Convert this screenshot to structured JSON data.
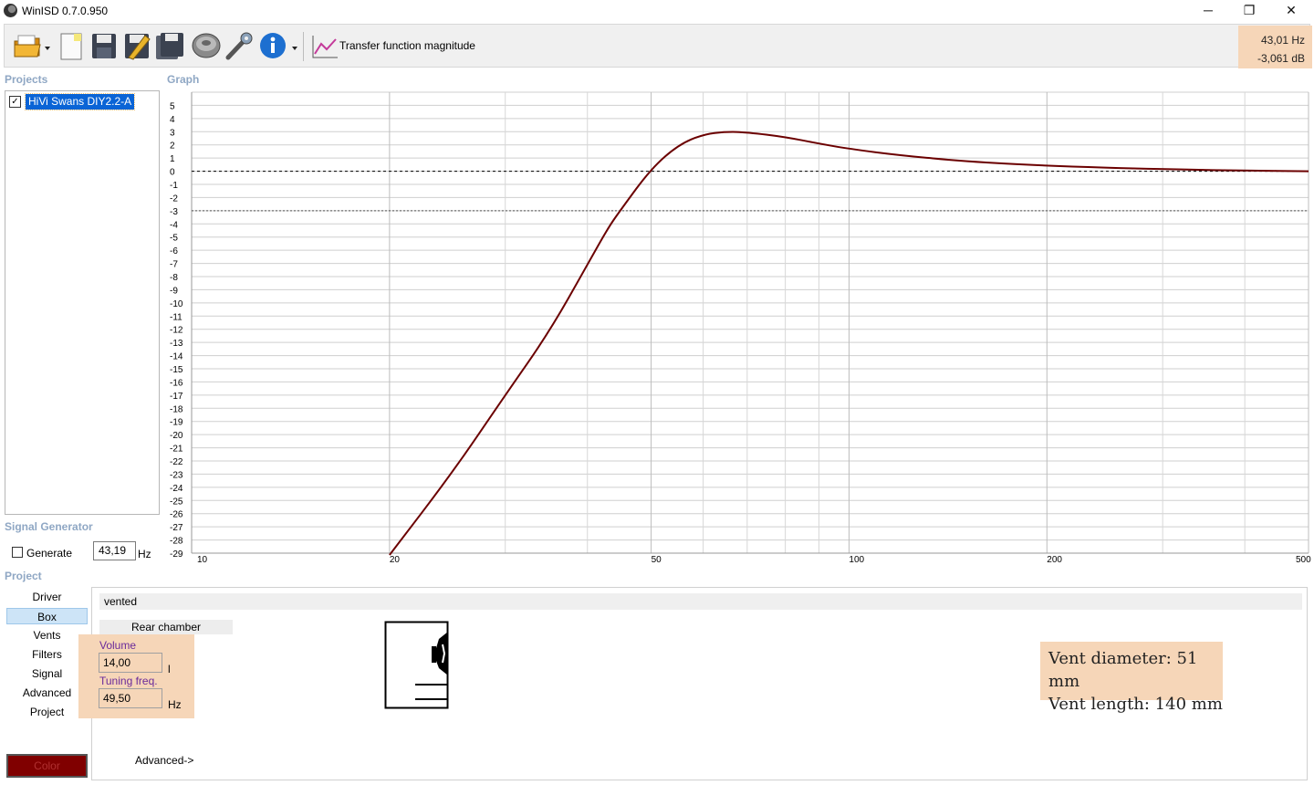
{
  "window": {
    "title": "WinISD 0.7.0.950",
    "minimize": "─",
    "restore": "❐",
    "close": "✕"
  },
  "toolbar": {
    "icons": [
      "open-folder-icon",
      "new-document-icon",
      "save-icon",
      "save-as-icon",
      "save-all-icon",
      "driver-icon",
      "tools-icon",
      "info-icon",
      "graph-type-icon"
    ],
    "graph_type_label": "Transfer function magnitude"
  },
  "cursor_readout": {
    "frequency": "43,01 Hz",
    "level": "-3,061 dB"
  },
  "projects": {
    "label": "Projects",
    "items": [
      {
        "name": "HiVi Swans DIY2.2-A",
        "checked": true
      }
    ]
  },
  "graph": {
    "label": "Graph"
  },
  "chart_data": {
    "type": "line",
    "title": "",
    "xlabel": "",
    "ylabel": "",
    "xscale": "log",
    "xlim": [
      10,
      500
    ],
    "ylim": [
      -29,
      5
    ],
    "x_tick_labels": [
      "10",
      "20",
      "50",
      "100",
      "200",
      "500"
    ],
    "y_tick_labels": [
      "5",
      "4",
      "3",
      "2",
      "1",
      "0",
      "-1",
      "-2",
      "-3",
      "-4",
      "-5",
      "-6",
      "-7",
      "-8",
      "-9",
      "-10",
      "-11",
      "-12",
      "-13",
      "-14",
      "-15",
      "-16",
      "-17",
      "-18",
      "-19",
      "-20",
      "-21",
      "-22",
      "-23",
      "-24",
      "-25",
      "-26",
      "-27",
      "-28",
      "-29"
    ],
    "reference_lines": [
      0,
      -3
    ],
    "grid": true,
    "series": [
      {
        "color": "#6b0000",
        "x": [
          20,
          25,
          30,
          35,
          40,
          43,
          45,
          50,
          55,
          60,
          65,
          70,
          80,
          90,
          100,
          120,
          150,
          200,
          300,
          400,
          500
        ],
        "y": [
          -29.8,
          -22.8,
          -17.0,
          -12.2,
          -7.1,
          -4.3,
          -2.9,
          0.2,
          2.0,
          2.8,
          3.0,
          2.95,
          2.6,
          2.1,
          1.7,
          1.2,
          0.75,
          0.4,
          0.15,
          0.05,
          0.0
        ]
      }
    ]
  },
  "signal_generator": {
    "label": "Signal Generator",
    "generate_label": "Generate",
    "generate_checked": false,
    "frequency": "43,19",
    "unit": "Hz"
  },
  "project_section": {
    "label": "Project",
    "nav": [
      "Driver",
      "Box",
      "Vents",
      "Filters",
      "Signal",
      "Advanced",
      "Project"
    ],
    "selected": "Box",
    "color_button": "Color",
    "color_value": "#800000"
  },
  "box": {
    "type": "vented",
    "rear_chamber_tab": "Rear chamber",
    "volume_label": "Volume",
    "volume_value": "14,00",
    "volume_unit": "l",
    "tuning_label": "Tuning freq.",
    "tuning_value": "49,50",
    "tuning_unit": "Hz",
    "advanced_link": "Advanced->"
  },
  "annotation": {
    "line1": "Vent diameter: 51 mm",
    "line2": "Vent length: 140 mm",
    "highlight_color": "#f6d6b8"
  }
}
